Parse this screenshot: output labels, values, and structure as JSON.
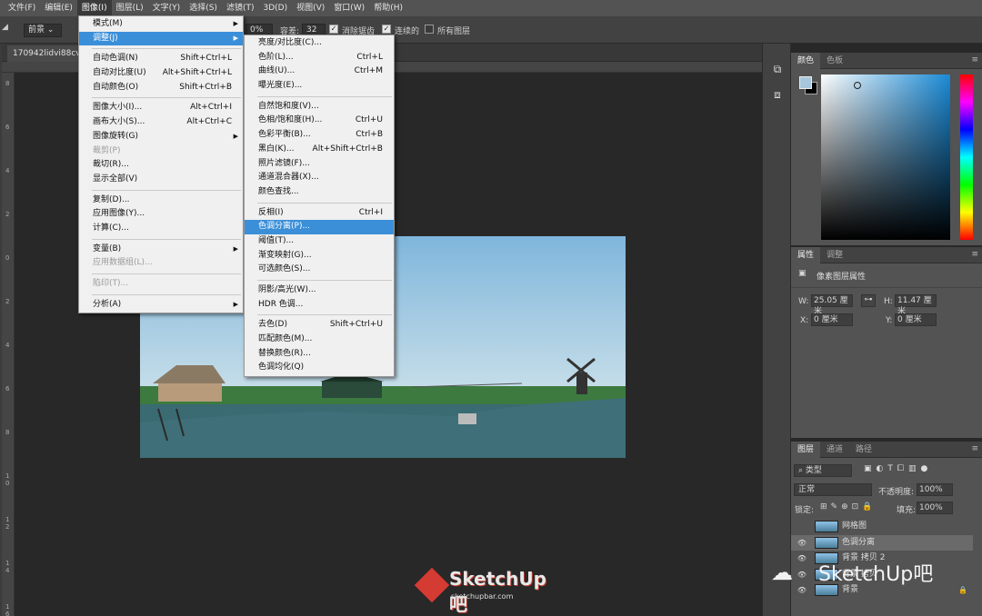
{
  "menubar": {
    "items": [
      "文件(F)",
      "编辑(E)",
      "图像(I)",
      "图层(L)",
      "文字(Y)",
      "选择(S)",
      "滤镜(T)",
      "3D(D)",
      "视图(V)",
      "窗口(W)",
      "帮助(H)"
    ]
  },
  "options": {
    "preset": "前景",
    "opacity_partial": "0%",
    "tolerance_label": "容差:",
    "tolerance_value": "32",
    "antialias_label": "消除锯齿",
    "contiguous_label": "连续的",
    "all_layers_label": "所有图层"
  },
  "document": {
    "tab_title": "170942lidvi88cvd"
  },
  "ruler_numbers": [
    "8",
    "6",
    "4",
    "2",
    "0",
    "2",
    "4",
    "6",
    "8",
    "1 0",
    "1 2",
    "1 4",
    "1 6"
  ],
  "image_menu": {
    "items": [
      {
        "label": "模式(M)",
        "shortcut": "",
        "submenu": true
      },
      {
        "label": "调整(J)",
        "shortcut": "",
        "submenu": true,
        "highlight": true
      },
      {
        "sep": true
      },
      {
        "label": "自动色调(N)",
        "shortcut": "Shift+Ctrl+L"
      },
      {
        "label": "自动对比度(U)",
        "shortcut": "Alt+Shift+Ctrl+L"
      },
      {
        "label": "自动颜色(O)",
        "shortcut": "Shift+Ctrl+B"
      },
      {
        "sep": true
      },
      {
        "label": "图像大小(I)...",
        "shortcut": "Alt+Ctrl+I"
      },
      {
        "label": "画布大小(S)...",
        "shortcut": "Alt+Ctrl+C"
      },
      {
        "label": "图像旋转(G)",
        "shortcut": "",
        "submenu": true
      },
      {
        "label": "裁剪(P)",
        "shortcut": "",
        "disabled": true
      },
      {
        "label": "裁切(R)...",
        "shortcut": ""
      },
      {
        "label": "显示全部(V)",
        "shortcut": ""
      },
      {
        "sep": true
      },
      {
        "label": "复制(D)...",
        "shortcut": ""
      },
      {
        "label": "应用图像(Y)...",
        "shortcut": ""
      },
      {
        "label": "计算(C)...",
        "shortcut": ""
      },
      {
        "sep": true
      },
      {
        "label": "变量(B)",
        "shortcut": "",
        "submenu": true
      },
      {
        "label": "应用数据组(L)...",
        "shortcut": "",
        "disabled": true
      },
      {
        "sep": true
      },
      {
        "label": "陷印(T)...",
        "shortcut": "",
        "disabled": true
      },
      {
        "sep": true
      },
      {
        "label": "分析(A)",
        "shortcut": "",
        "submenu": true
      }
    ]
  },
  "adjust_menu": {
    "items": [
      {
        "label": "亮度/对比度(C)...",
        "shortcut": ""
      },
      {
        "label": "色阶(L)...",
        "shortcut": "Ctrl+L"
      },
      {
        "label": "曲线(U)...",
        "shortcut": "Ctrl+M"
      },
      {
        "label": "曝光度(E)...",
        "shortcut": ""
      },
      {
        "sep": true
      },
      {
        "label": "自然饱和度(V)...",
        "shortcut": ""
      },
      {
        "label": "色相/饱和度(H)...",
        "shortcut": "Ctrl+U"
      },
      {
        "label": "色彩平衡(B)...",
        "shortcut": "Ctrl+B"
      },
      {
        "label": "黑白(K)...",
        "shortcut": "Alt+Shift+Ctrl+B"
      },
      {
        "label": "照片滤镜(F)...",
        "shortcut": ""
      },
      {
        "label": "通道混合器(X)...",
        "shortcut": ""
      },
      {
        "label": "颜色查找...",
        "shortcut": ""
      },
      {
        "sep": true
      },
      {
        "label": "反相(I)",
        "shortcut": "Ctrl+I"
      },
      {
        "label": "色调分离(P)...",
        "shortcut": "",
        "highlight": true
      },
      {
        "label": "阈值(T)...",
        "shortcut": ""
      },
      {
        "label": "渐变映射(G)...",
        "shortcut": ""
      },
      {
        "label": "可选颜色(S)...",
        "shortcut": ""
      },
      {
        "sep": true
      },
      {
        "label": "阴影/高光(W)...",
        "shortcut": ""
      },
      {
        "label": "HDR 色调...",
        "shortcut": ""
      },
      {
        "sep": true
      },
      {
        "label": "去色(D)",
        "shortcut": "Shift+Ctrl+U"
      },
      {
        "label": "匹配颜色(M)...",
        "shortcut": ""
      },
      {
        "label": "替换颜色(R)...",
        "shortcut": ""
      },
      {
        "label": "色调均化(Q)",
        "shortcut": ""
      }
    ]
  },
  "color_panel": {
    "tabs": [
      "颜色",
      "色板"
    ],
    "foreground": "#a8c6dc",
    "background": "#000000"
  },
  "properties_panel": {
    "tabs": [
      "属性",
      "调整"
    ],
    "header": "像素图层属性",
    "w_label": "W:",
    "w_value": "25.05 厘米",
    "h_label": "H:",
    "h_value": "11.47 厘米",
    "x_label": "X:",
    "x_value": "0 厘米",
    "y_label": "Y:",
    "y_value": "0 厘米"
  },
  "layers_panel": {
    "tabs": [
      "图层",
      "通道",
      "路径"
    ],
    "filter_label": "类型",
    "blend_mode": "正常",
    "opacity_label": "不透明度:",
    "opacity_value": "100%",
    "lock_label": "锁定:",
    "fill_label": "填充:",
    "fill_value": "100%",
    "layers": [
      {
        "name": "网格图",
        "visible": false,
        "selected": false
      },
      {
        "name": "色调分离",
        "visible": true,
        "selected": true
      },
      {
        "name": "背景 拷贝 2",
        "visible": true,
        "selected": false
      },
      {
        "name": "背景 拷贝",
        "visible": true,
        "selected": false
      },
      {
        "name": "背景",
        "visible": true,
        "selected": false,
        "locked": true
      }
    ]
  },
  "watermarks": {
    "center_brand": "SketchUp吧",
    "center_url": "sketchupbar.com",
    "right_brand": "SketchUp吧"
  }
}
